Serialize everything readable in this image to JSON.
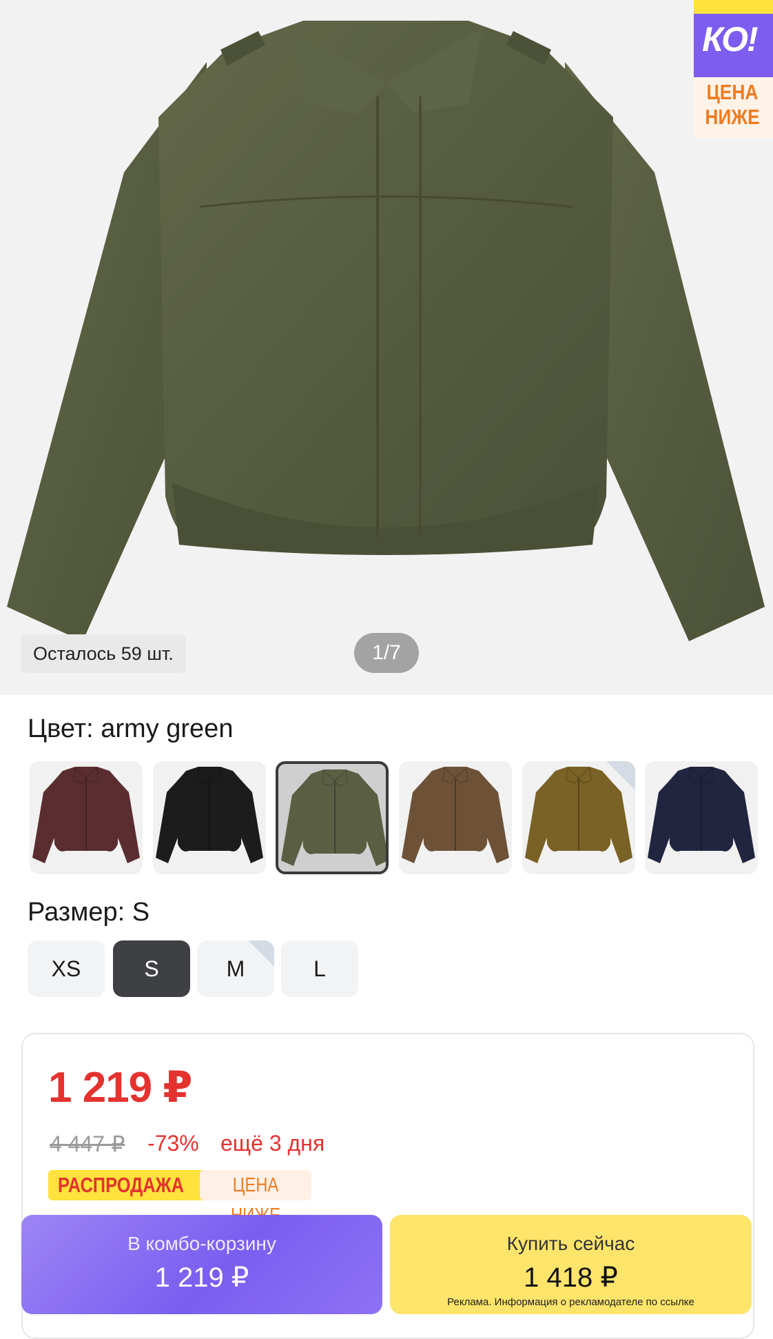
{
  "gallery": {
    "stock_text": "Осталось 59 шт.",
    "counter": "1/7",
    "badge": {
      "logo": "КО!",
      "line1": "ЦЕНА",
      "line2": "НИЖЕ"
    }
  },
  "color": {
    "label": "Цвет: army green",
    "swatches": [
      {
        "name": "wine",
        "hex": "#5a2e30"
      },
      {
        "name": "black",
        "hex": "#1c1c1c"
      },
      {
        "name": "army green",
        "hex": "#5a5f44",
        "selected": true
      },
      {
        "name": "brown",
        "hex": "#6e5238"
      },
      {
        "name": "olive",
        "hex": "#7a6226"
      },
      {
        "name": "navy",
        "hex": "#22253f"
      }
    ]
  },
  "size": {
    "label": "Размер: S",
    "options": [
      "XS",
      "S",
      "M",
      "L"
    ],
    "selected": "S"
  },
  "price": {
    "current": "1 219 ₽",
    "old": "4 447 ₽",
    "discount": "-73%",
    "days_left": "ещё 3 дня",
    "sale_tag": "РАСПРОДАЖА",
    "lower_tag": "ЦЕНА НИЖЕ"
  },
  "combo_button": {
    "label": "В комбо-корзину",
    "price": "1 219 ₽"
  },
  "buy_button": {
    "label": "Купить сейчас",
    "price": "1 418 ₽",
    "ad_note": "Реклама. Информация о рекламодателе по ссылке"
  },
  "colors": {
    "accent_red": "#e4322f",
    "combo_purple": "#7a5ef0",
    "buy_yellow": "#fde46a",
    "jacket_green": "#5a5f44"
  }
}
